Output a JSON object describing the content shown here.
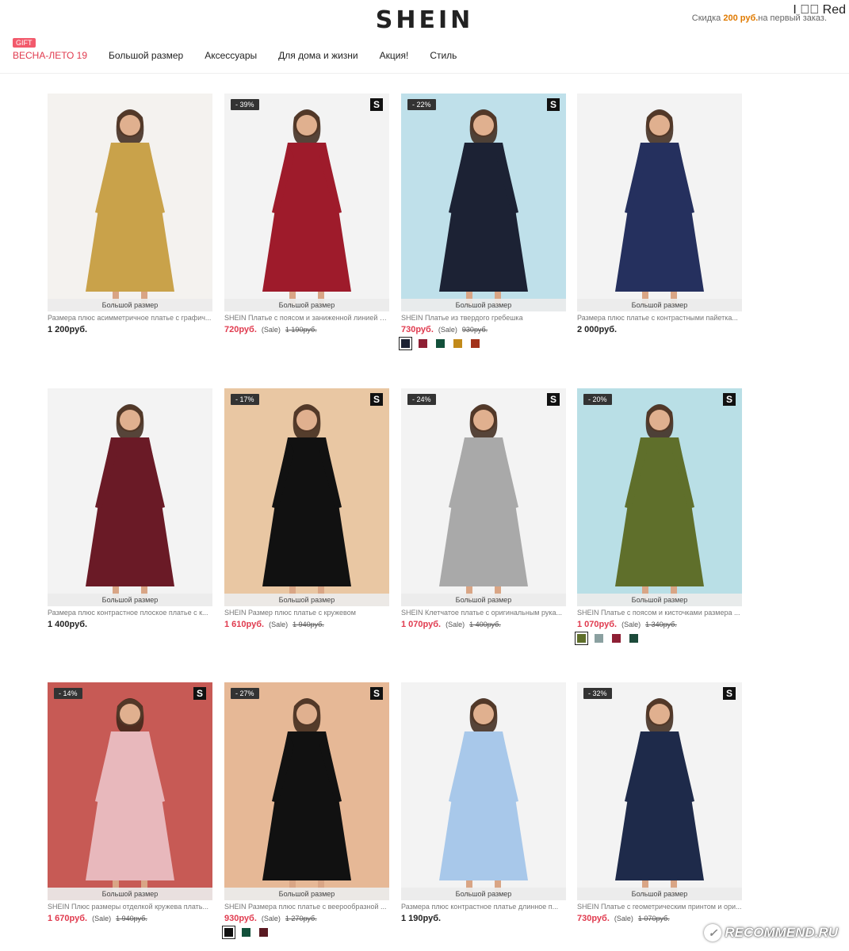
{
  "header": {
    "logo": "SHEIN",
    "account": "I ⃞⃞ Red",
    "promo_prefix": "Скидка ",
    "promo_amount": "200 руб.",
    "promo_suffix": "на первый заказ."
  },
  "nav": {
    "gift_label": "GIFT",
    "items": [
      "ВЕСНА-ЛЕТО 19",
      "Большой размер",
      "Аксессуары",
      "Для дома и жизни",
      "Акция!",
      "Стиль"
    ]
  },
  "products": [
    {
      "size_tag": "Большой размер",
      "name": "Размера плюс асимметричное платье с графич...",
      "price": "1 200руб.",
      "on_sale": false,
      "badge": "",
      "has_s": false,
      "photo_bg": "#f4f2ef",
      "dress_color": "#c9a24a",
      "swatches": []
    },
    {
      "size_tag": "Большой размер",
      "name": "SHEIN Платье с поясом и заниженной линией п...",
      "price": "720руб.",
      "on_sale": true,
      "sale_label": "(Sale)",
      "old_price": "1 190руб.",
      "badge": "- 39%",
      "has_s": true,
      "photo_bg": "#f3f3f3",
      "dress_color": "#9e1b2b",
      "swatches": []
    },
    {
      "size_tag": "Большой размер",
      "name": "SHEIN Платье из твердого гребешка",
      "price": "730руб.",
      "on_sale": true,
      "sale_label": "(Sale)",
      "old_price": "930руб.",
      "badge": "- 22%",
      "has_s": true,
      "photo_bg": "#bfe0ea",
      "dress_color": "#1c2234",
      "swatches": [
        "#1c2234",
        "#8e1f34",
        "#12503a",
        "#c28a1a",
        "#a2321a"
      ]
    },
    {
      "size_tag": "Большой размер",
      "name": "Размера плюс платье с контрастными пайетка...",
      "price": "2 000руб.",
      "on_sale": false,
      "badge": "",
      "has_s": false,
      "photo_bg": "#f3f3f3",
      "dress_color": "#25305e",
      "swatches": []
    },
    {
      "size_tag": "Большой размер",
      "name": "Размера плюс контрастное плоское платье с к...",
      "price": "1 400руб.",
      "on_sale": false,
      "badge": "",
      "has_s": false,
      "photo_bg": "#f3f3f3",
      "dress_color": "#6a1a26",
      "swatches": []
    },
    {
      "size_tag": "Большой размер",
      "name": "SHEIN Размер плюс платье с кружевом",
      "price": "1 610руб.",
      "on_sale": true,
      "sale_label": "(Sale)",
      "old_price": "1 940руб.",
      "badge": "- 17%",
      "has_s": true,
      "photo_bg": "#e9c7a3",
      "dress_color": "#111111",
      "swatches": []
    },
    {
      "size_tag": "Большой размер",
      "name": "SHEIN Клетчатое платье с оригинальным рука...",
      "price": "1 070руб.",
      "on_sale": true,
      "sale_label": "(Sale)",
      "old_price": "1 400руб.",
      "badge": "- 24%",
      "has_s": true,
      "photo_bg": "#f3f3f3",
      "dress_color": "#a9a9a9",
      "swatches": []
    },
    {
      "size_tag": "Большой размер",
      "name": "SHEIN Платье с поясом и кисточками размера ...",
      "price": "1 070руб.",
      "on_sale": true,
      "sale_label": "(Sale)",
      "old_price": "1 340руб.",
      "badge": "- 20%",
      "has_s": true,
      "photo_bg": "#b9dfe6",
      "dress_color": "#5f6f2b",
      "swatches": [
        "#5f6f2b",
        "#8aa0a0",
        "#8e1f34",
        "#1c4a3a"
      ]
    },
    {
      "size_tag": "Большой размер",
      "name": "SHEIN Плюс размеры отделкой кружева плать...",
      "price": "1 670руб.",
      "on_sale": true,
      "sale_label": "(Sale)",
      "old_price": "1 940руб.",
      "badge": "- 14%",
      "has_s": true,
      "photo_bg": "#c75a55",
      "dress_color": "#e8b8bc",
      "swatches": []
    },
    {
      "size_tag": "Большой размер",
      "name": "SHEIN Размера плюс платье с веерообразной ...",
      "price": "930руб.",
      "on_sale": true,
      "sale_label": "(Sale)",
      "old_price": "1 270руб.",
      "badge": "- 27%",
      "has_s": true,
      "photo_bg": "#e6b896",
      "dress_color": "#111111",
      "swatches": [
        "#111111",
        "#12503a",
        "#5a1a22"
      ]
    },
    {
      "size_tag": "Большой размер",
      "name": "Размера плюс контрастное платье длинное п...",
      "price": "1 190руб.",
      "on_sale": false,
      "badge": "",
      "has_s": false,
      "photo_bg": "#f3f3f3",
      "dress_color": "#a8c8ea",
      "swatches": []
    },
    {
      "size_tag": "Большой размер",
      "name": "SHEIN Платье с геометрическим принтом и ори...",
      "price": "730руб.",
      "on_sale": true,
      "sale_label": "(Sale)",
      "old_price": "1 070руб.",
      "badge": "- 32%",
      "has_s": true,
      "photo_bg": "#f3f3f3",
      "dress_color": "#1e2a4a",
      "swatches": []
    }
  ],
  "watermark": "RECOMMEND.RU",
  "s_icon_label": "S"
}
